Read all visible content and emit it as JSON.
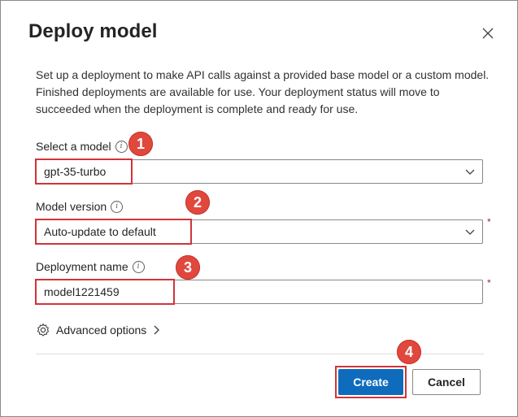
{
  "dialog": {
    "title": "Deploy model",
    "description": "Set up a deployment to make API calls against a provided base model or a custom model. Finished deployments are available for use. Your deployment status will move to succeeded when the deployment is complete and ready for use."
  },
  "fields": {
    "model": {
      "label": "Select a model",
      "value": "gpt-35-turbo"
    },
    "version": {
      "label": "Model version",
      "value": "Auto-update to default",
      "required_mark": "*"
    },
    "name": {
      "label": "Deployment name",
      "value": "model1221459",
      "required_mark": "*"
    }
  },
  "advanced": {
    "label": "Advanced options"
  },
  "buttons": {
    "create": "Create",
    "cancel": "Cancel"
  },
  "callouts": [
    "1",
    "2",
    "3",
    "4"
  ],
  "colors": {
    "primary": "#0f6cbd",
    "callout": "#e0483e",
    "highlight": "#d13438"
  }
}
